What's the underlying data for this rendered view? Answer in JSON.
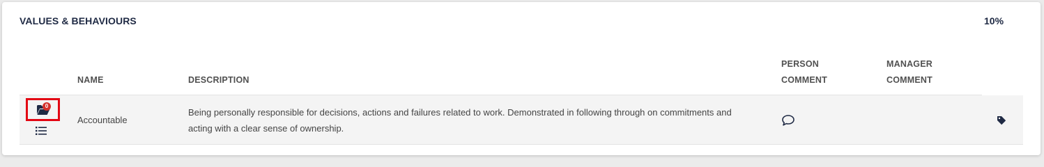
{
  "section": {
    "title": "VALUES & BEHAVIOURS",
    "weight": "10%"
  },
  "table": {
    "headers": {
      "name": "NAME",
      "description": "DESCRIPTION",
      "person_comment": "PERSON COMMENT",
      "manager_comment": "MANAGER COMMENT"
    },
    "rows": [
      {
        "attachment_count": "0",
        "name": "Accountable",
        "description": "Being personally responsible for decisions, actions and failures related to work. Demonstrated in following through on commitments and acting with a clear sense of ownership.",
        "person_comment_icon": "speech-bubble-icon",
        "manager_comment": "",
        "action_icon": "tag-icon"
      }
    ]
  },
  "icons": {
    "folder": "folder-open-icon",
    "list": "list-icon",
    "comment": "speech-bubble-icon",
    "tag": "tag-icon"
  },
  "colors": {
    "title": "#1f2a44",
    "highlight_border": "#e30613",
    "badge": "#d4322c",
    "icon": "#1f2a44",
    "row_background": "#f4f4f4"
  }
}
